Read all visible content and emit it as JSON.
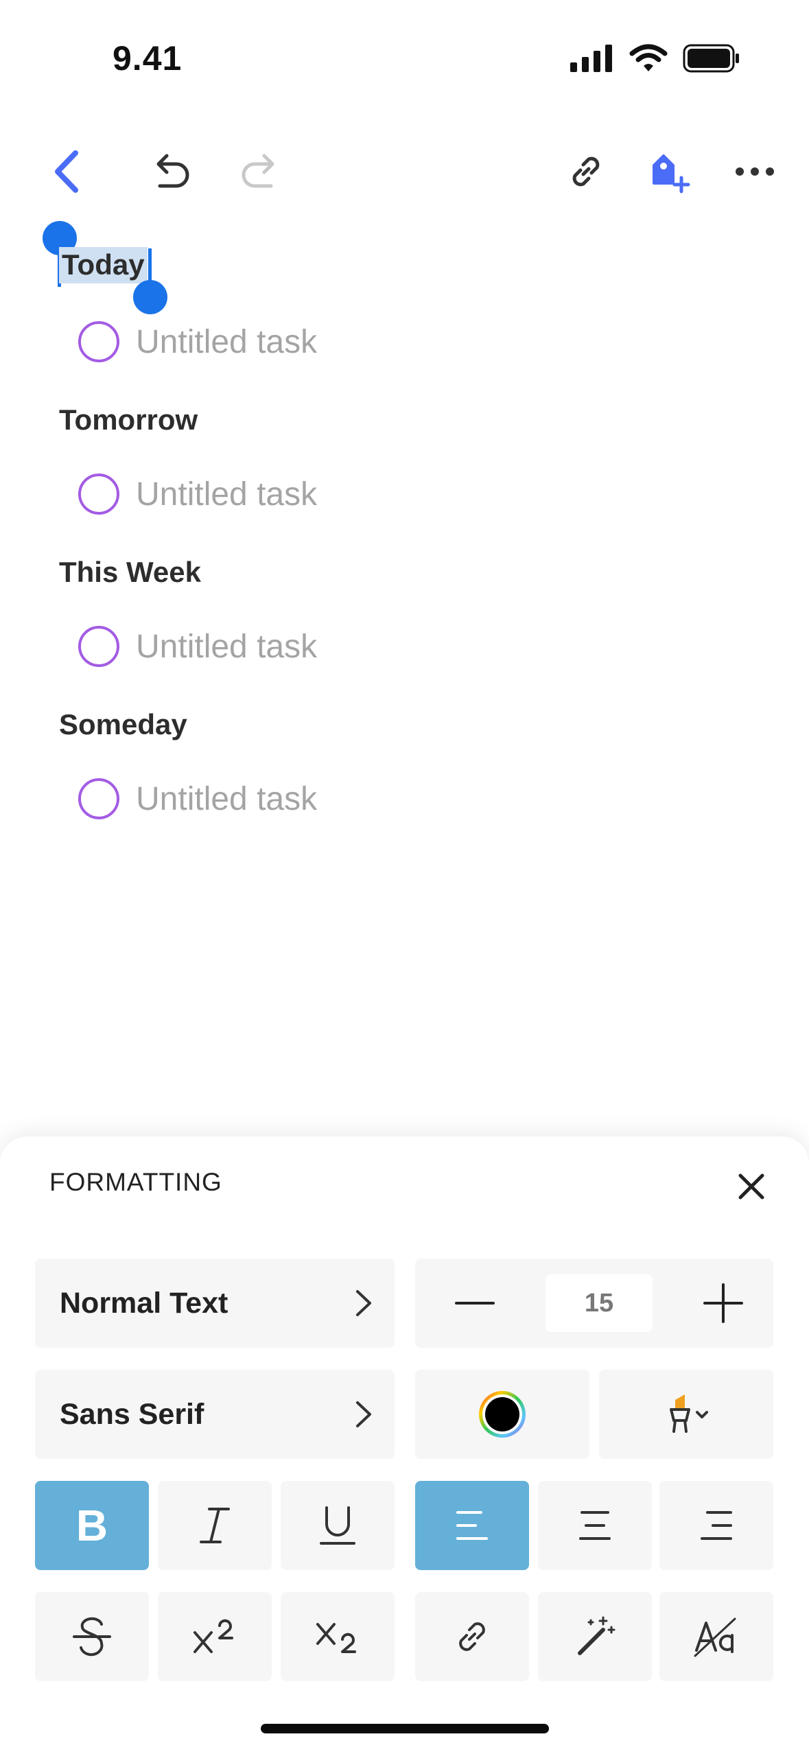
{
  "status_bar": {
    "time": "9.41"
  },
  "toolbar": {
    "back": "chevron-left-icon",
    "undo": "undo-icon",
    "redo": "redo-icon",
    "link": "link-icon",
    "tag": "tag-add-icon",
    "more": "more-icon"
  },
  "content": {
    "sections": [
      {
        "title": "Today",
        "task": "Untitled task"
      },
      {
        "title": "Tomorrow",
        "task": "Untitled task"
      },
      {
        "title": "This Week",
        "task": "Untitled task"
      },
      {
        "title": "Someday",
        "task": "Untitled task"
      }
    ]
  },
  "formatting": {
    "title": "FORMATTING",
    "text_style": "Normal Text",
    "font": "Sans Serif",
    "font_size": "15",
    "bold": "B",
    "colors": {
      "accent": "#4a6cf7",
      "active": "#64b0d8",
      "task_circle": "#a35ce3",
      "selection": "#1a73e8"
    }
  }
}
